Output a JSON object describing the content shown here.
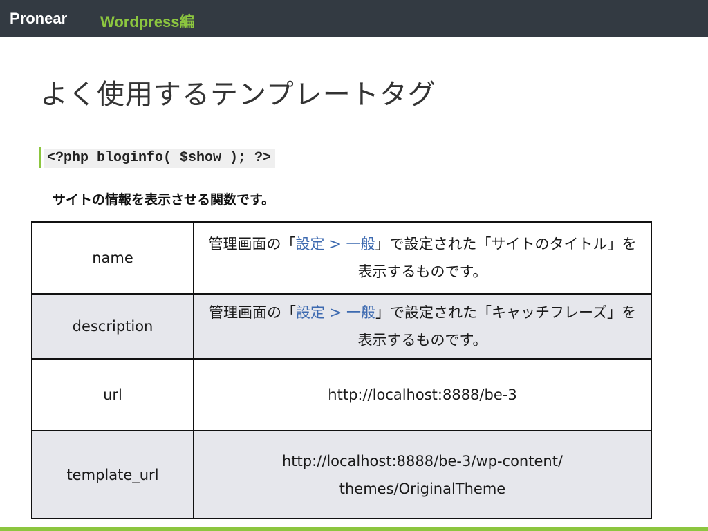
{
  "header": {
    "brand": "Pronear",
    "section": "Wordpress編"
  },
  "page": {
    "title": "よく使用するテンプレートタグ",
    "code": "<?php bloginfo( $show ); ?>",
    "description": "サイトの情報を表示させる関数です。"
  },
  "table": {
    "rows": [
      {
        "key": "name",
        "value": {
          "prefix": "管理画面の「",
          "link1": "設定",
          "sep": " > ",
          "link2": "一般",
          "suffix": "」で設定された「サイトのタイトル」を表示するものです。"
        }
      },
      {
        "key": "description",
        "value": {
          "prefix": "管理画面の「",
          "link1": "設定",
          "sep": " > ",
          "link2": "一般",
          "suffix": "」で設定された「キャッチフレーズ」を表示するものです。"
        }
      },
      {
        "key": "url",
        "value_text": "http://localhost:8888/be-3"
      },
      {
        "key": "template_url",
        "value_line1": "http://localhost:8888/be-3/wp-content/",
        "value_line2": "themes/OriginalTheme"
      }
    ]
  },
  "colors": {
    "topbar": "#333a42",
    "accent_green": "#8cc63f",
    "link_blue": "#3d6ab0",
    "alt_row": "#e6e7ec"
  }
}
